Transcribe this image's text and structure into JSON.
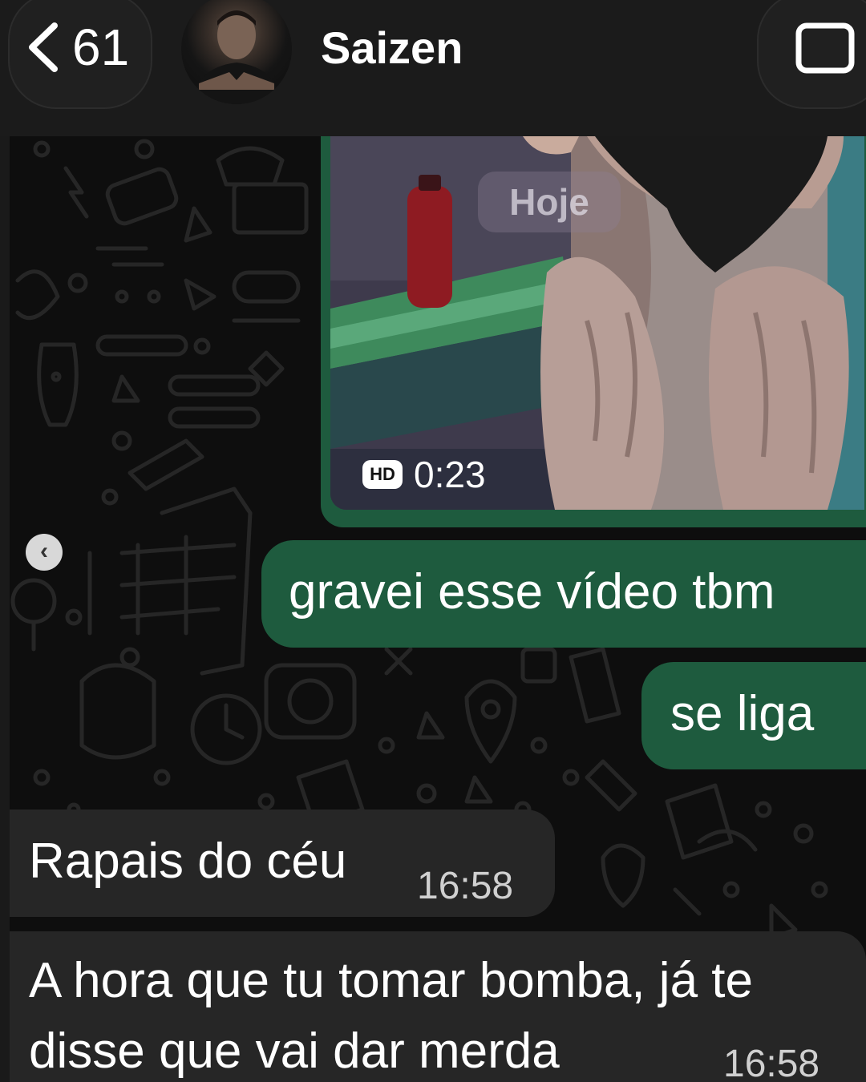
{
  "header": {
    "back_count": "61",
    "contact_name": "Saizen",
    "avatar_icon": "contact-avatar",
    "video_call_icon": "video-call-icon"
  },
  "messages": {
    "video": {
      "hd_label": "HD",
      "duration": "0:23",
      "date_chip": "Hoje"
    },
    "outgoing": [
      {
        "text": "gravei esse vídeo tbm"
      },
      {
        "text": "se liga"
      }
    ],
    "incoming": [
      {
        "text": "Rapais do céu",
        "time": "16:58"
      },
      {
        "text": "A hora que tu tomar bomba, já te disse que vai dar merda",
        "time": "16:58"
      }
    ]
  },
  "colors": {
    "outgoing_bubble": "#1e5b3e",
    "incoming_bubble": "#262626",
    "header_bg": "#1b1b1b",
    "chat_bg": "#0e0e0e"
  }
}
